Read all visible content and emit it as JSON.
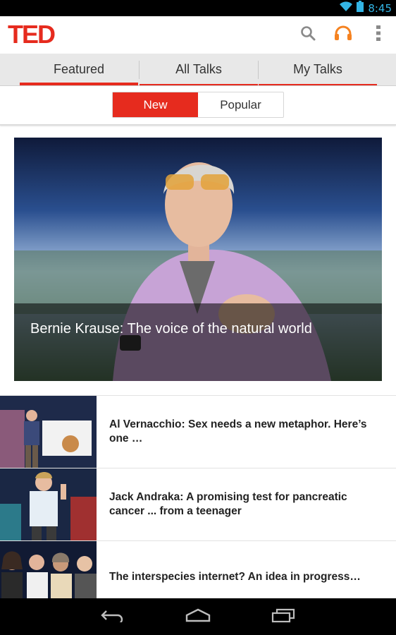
{
  "status_bar": {
    "time": "8:45",
    "icons": [
      "wifi-icon",
      "battery-icon"
    ]
  },
  "app_bar": {
    "logo_text": "TED",
    "actions": [
      {
        "name": "search-icon"
      },
      {
        "name": "headphones-icon",
        "color": "#f58220"
      },
      {
        "name": "overflow-menu-icon"
      }
    ]
  },
  "tabs": [
    {
      "label": "Featured",
      "active": true
    },
    {
      "label": "All Talks",
      "active": false
    },
    {
      "label": "My Talks",
      "active": false
    }
  ],
  "segment": {
    "options": [
      "New",
      "Popular"
    ],
    "selected": "New"
  },
  "hero": {
    "title": "Bernie Krause: The voice of the natural world"
  },
  "talks": [
    {
      "title": "Al Vernacchio: Sex needs a new metaphor. Here’s one …"
    },
    {
      "title": "Jack Andraka: A promising test for pancreatic cancer ... from a teenager"
    },
    {
      "title": "The interspecies internet? An idea in progress…"
    }
  ],
  "nav_bar": {
    "buttons": [
      "back-icon",
      "home-icon",
      "recents-icon"
    ]
  },
  "colors": {
    "brand": "#e62b1e",
    "accent": "#f58220",
    "status_time": "#33b5e5"
  }
}
